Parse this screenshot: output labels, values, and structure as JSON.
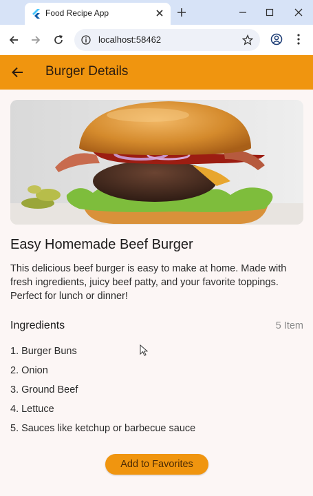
{
  "browser": {
    "tab_title": "Food Recipe App",
    "url": "localhost:58462",
    "icons": {
      "favicon": "flutter-icon",
      "close_tab": "close-icon",
      "new_tab": "plus-icon",
      "minimize": "minimize-icon",
      "maximize": "maximize-icon",
      "close_window": "close-icon",
      "back": "arrow-left-icon",
      "forward": "arrow-right-icon",
      "reload": "reload-icon",
      "site_info": "info-icon",
      "bookmark": "star-icon",
      "profile": "profile-icon",
      "menu": "kebab-menu-icon"
    }
  },
  "appbar": {
    "title": "Burger Details",
    "back_icon": "arrow-back-icon",
    "color": "#f0950f"
  },
  "recipe": {
    "title": "Easy Homemade Beef Burger",
    "description": "This delicious beef burger is easy to make at home. Made with fresh ingredients, juicy beef patty, and your favorite toppings. Perfect for lunch or dinner!",
    "image": "burger-photo"
  },
  "ingredients": {
    "header": "Ingredients",
    "count_label": "5 Item",
    "items": [
      "1. Burger Buns",
      "2. Onion",
      "3. Ground Beef",
      "4. Lettuce",
      "5. Sauces like ketchup or barbecue sauce"
    ]
  },
  "actions": {
    "favorite_label": "Add to Favorites"
  },
  "colors": {
    "accent": "#f0950f",
    "background": "#fcf6f5"
  }
}
